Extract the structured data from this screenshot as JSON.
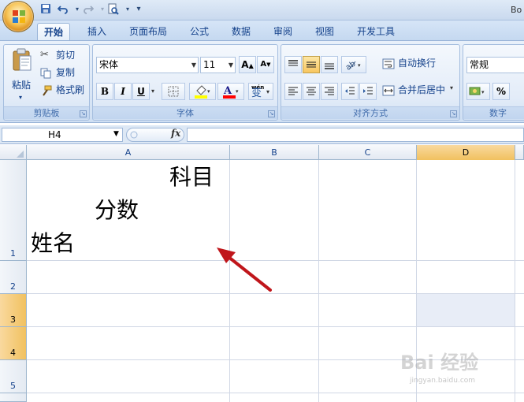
{
  "window": {
    "title_fragment": "Bo"
  },
  "tabs": [
    {
      "label": "开始",
      "active": true
    },
    {
      "label": "插入"
    },
    {
      "label": "页面布局"
    },
    {
      "label": "公式"
    },
    {
      "label": "数据"
    },
    {
      "label": "审阅"
    },
    {
      "label": "视图"
    },
    {
      "label": "开发工具"
    }
  ],
  "clipboard": {
    "paste": "粘贴",
    "cut": "剪切",
    "copy": "复制",
    "format_painter": "格式刷",
    "label": "剪贴板"
  },
  "font": {
    "name": "宋体",
    "size": "11",
    "bold": "B",
    "italic": "I",
    "underline": "U",
    "grow": "A",
    "shrink": "A",
    "phonetic": "wén",
    "phonetic_char": "变",
    "label": "字体",
    "highlight_color": "#ffff00",
    "font_color": "#ff0000"
  },
  "alignment": {
    "wrap_text": "自动换行",
    "merge_center": "合并后居中",
    "label": "对齐方式"
  },
  "number": {
    "format": "常规",
    "percent": "%",
    "label": "数字"
  },
  "formula_bar": {
    "name_box": "H4",
    "fx": "fx",
    "value": ""
  },
  "grid": {
    "columns": [
      "A",
      "B",
      "C",
      "D"
    ],
    "active_column": "D",
    "rows": [
      "1",
      "2",
      "3",
      "4",
      "5"
    ],
    "active_rows": [
      "3",
      "4"
    ],
    "cell_a1": {
      "line1": "科目",
      "line2": "分数",
      "line3": "姓名"
    }
  },
  "annotation": {
    "color": "#c0161b"
  },
  "watermark": {
    "text": "Bai 经验",
    "sub": "jingyan.baidu.com"
  }
}
